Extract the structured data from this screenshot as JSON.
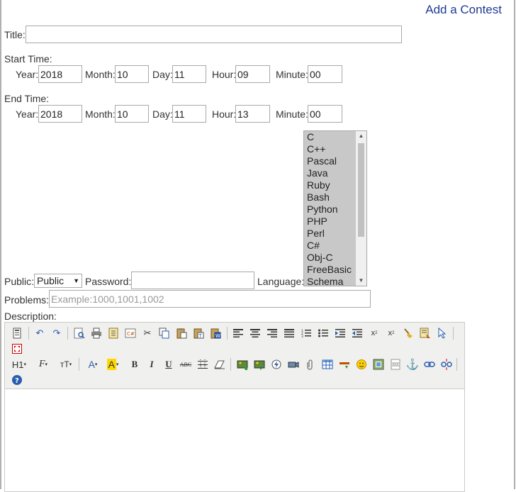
{
  "page": {
    "heading": "Add a Contest"
  },
  "title_field": {
    "label": "Title:",
    "value": ""
  },
  "start_time": {
    "label": "Start Time:",
    "year_label": "Year:",
    "year": "2018",
    "month_label": "Month:",
    "month": "10",
    "day_label": "Day:",
    "day": "11",
    "hour_label": "Hour:",
    "hour": "09",
    "minute_label": "Minute:",
    "minute": "00"
  },
  "end_time": {
    "label": "End Time:",
    "year_label": "Year:",
    "year": "2018",
    "month_label": "Month:",
    "month": "10",
    "day_label": "Day:",
    "day": "11",
    "hour_label": "Hour:",
    "hour": "13",
    "minute_label": "Minute:",
    "minute": "00"
  },
  "public": {
    "label": "Public:",
    "selected": "Public"
  },
  "password": {
    "label": "Password:",
    "value": ""
  },
  "language": {
    "label": "Language:",
    "options": [
      "C",
      "C++",
      "Pascal",
      "Java",
      "Ruby",
      "Bash",
      "Python",
      "PHP",
      "Perl",
      "C#",
      "Obj-C",
      "FreeBasic",
      "Schema"
    ]
  },
  "problems": {
    "label": "Problems:",
    "placeholder": "Example:1000,1001,1002",
    "value": ""
  },
  "description": {
    "label": "Description:"
  },
  "toolbar": {
    "heading_label": "H1",
    "font_label": "F",
    "size_label": "тT",
    "font_color_label": "A",
    "bg_color_label": "A",
    "bold_label": "B",
    "italic_label": "I",
    "underline_label": "U",
    "strike_label": "ABC",
    "sub_label": "x",
    "sup_label": "x"
  },
  "colors": {
    "accent": "#1f3a93",
    "listbox_bg": "#c8c8c8",
    "toolbar_bg": "#f0f0ee"
  }
}
